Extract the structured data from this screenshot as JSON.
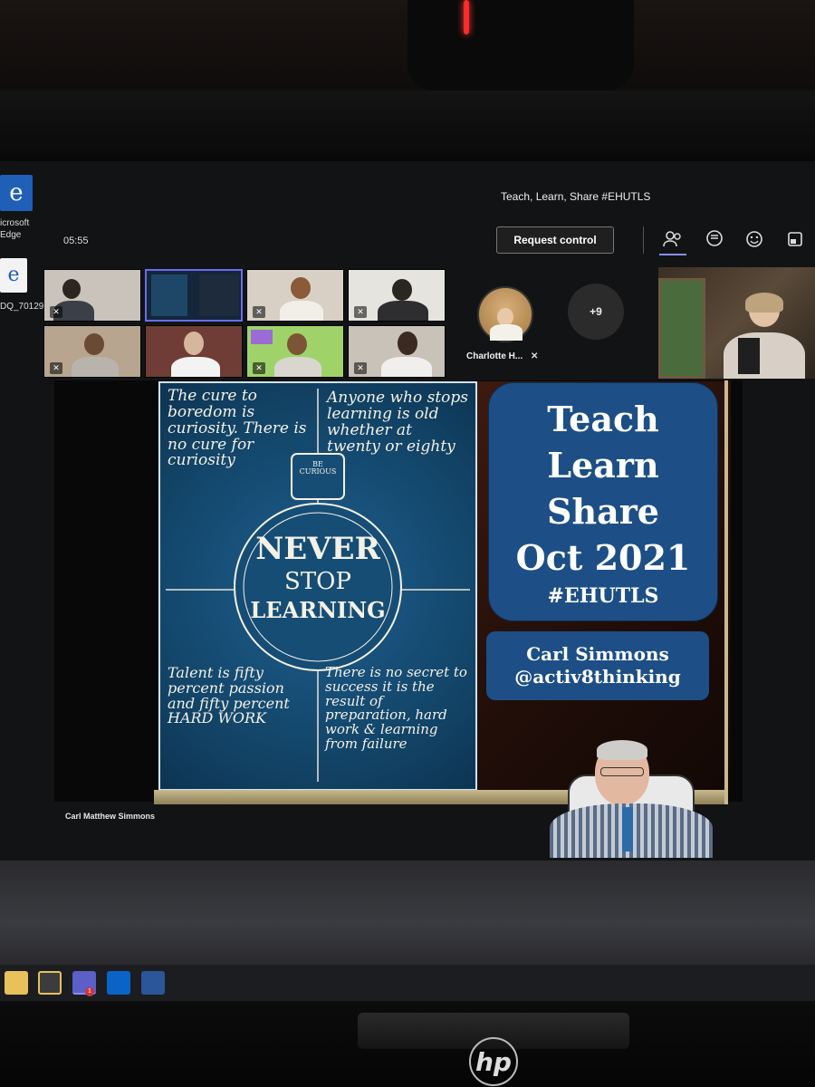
{
  "desktop": {
    "icons": [
      {
        "label": "icrosoft\nEdge",
        "icon": "edge-icon"
      },
      {
        "label": "DQ_70129",
        "icon": "edge-file-icon"
      }
    ]
  },
  "meeting": {
    "title": "Teach, Learn, Share #EHUTLS",
    "timer": "05:55",
    "request_control_label": "Request control",
    "toolbar_icons": [
      "participants-icon",
      "chat-icon",
      "reactions-icon",
      "view-icon"
    ]
  },
  "participants": {
    "named": {
      "name": "Charlotte H...",
      "muted": true
    },
    "overflow_count": "+9"
  },
  "slide": {
    "poster": {
      "tl": "The cure to boredom is curiosity. There is no cure for curiosity",
      "tr": "Anyone who stops learning is old whether at twenty or eighty",
      "center_top": "NEVER",
      "center_mid": "STOP",
      "center_bot": "LEARNING",
      "badge": "BE CURIOUS",
      "bl": "Talent is fifty percent passion and fifty percent HARD WORK",
      "br": "There is no secret to success it is the result of preparation, hard work & learning from failure"
    },
    "title_lines": [
      "Teach",
      "Learn",
      "Share",
      "Oct 2021"
    ],
    "hashtag": "#EHUTLS",
    "presenter_name": "Carl Simmons",
    "presenter_handle": "@activ8thinking"
  },
  "presenter_label": "Carl Matthew Simmons",
  "taskbar": {
    "apps": [
      "file-explorer-icon",
      "store-icon",
      "teams-icon",
      "outlook-icon",
      "word-icon"
    ],
    "teams_badge": "1"
  },
  "brand": "hp"
}
